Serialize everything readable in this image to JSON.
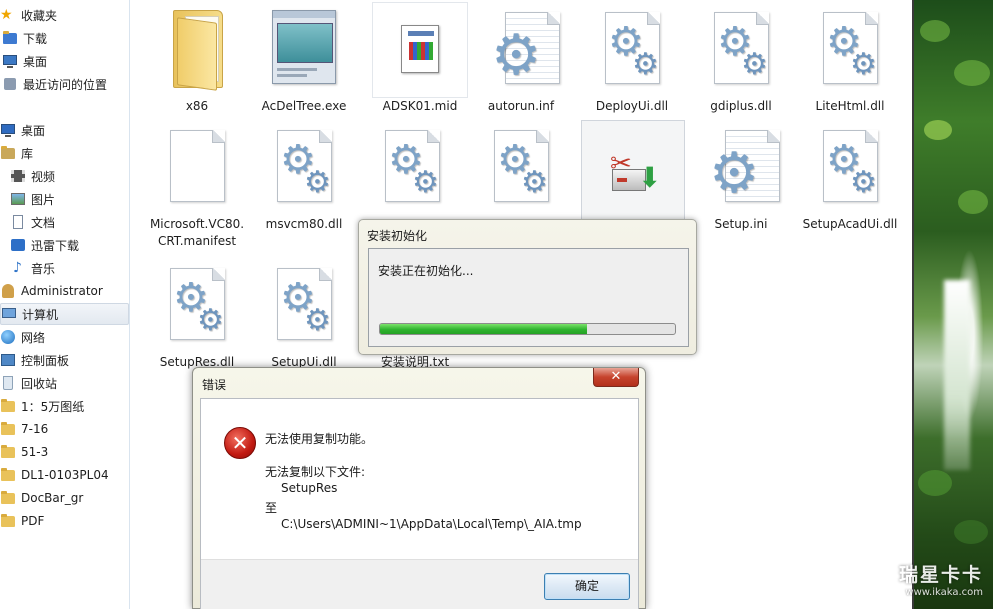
{
  "nav": {
    "items": [
      {
        "label": "收藏夹",
        "icon": "star-icon"
      },
      {
        "label": "下载",
        "icon": "download-folder-icon"
      },
      {
        "label": "桌面",
        "icon": "desktop-icon"
      },
      {
        "label": "最近访问的位置",
        "icon": "recent-places-icon"
      },
      {
        "label": "桌面",
        "icon": "desktop-icon"
      },
      {
        "label": "库",
        "icon": "library-icon"
      },
      {
        "label": "视频",
        "icon": "video-icon"
      },
      {
        "label": "图片",
        "icon": "pictures-icon"
      },
      {
        "label": "文档",
        "icon": "documents-icon"
      },
      {
        "label": "迅雷下载",
        "icon": "xunlei-download-icon"
      },
      {
        "label": "音乐",
        "icon": "music-icon"
      },
      {
        "label": "Administrator",
        "icon": "user-folder-icon"
      },
      {
        "label": "计算机",
        "icon": "computer-icon"
      },
      {
        "label": "网络",
        "icon": "network-icon"
      },
      {
        "label": "控制面板",
        "icon": "control-panel-icon"
      },
      {
        "label": "回收站",
        "icon": "recycle-bin-icon"
      },
      {
        "label": "1：5万图纸",
        "icon": "folder-icon"
      },
      {
        "label": "7-16",
        "icon": "folder-icon"
      },
      {
        "label": "51-3",
        "icon": "folder-icon"
      },
      {
        "label": "DL1-0103PL04",
        "icon": "folder-icon"
      },
      {
        "label": "DocBar_gr",
        "icon": "folder-icon"
      },
      {
        "label": "PDF",
        "icon": "folder-icon"
      }
    ],
    "selected_index": 12
  },
  "files": [
    {
      "name": "x86",
      "icon": "folder-icon"
    },
    {
      "name": "AcDelTree.exe",
      "icon": "application-icon"
    },
    {
      "name": "ADSK01.mid",
      "icon": "media-file-icon"
    },
    {
      "name": "autorun.inf",
      "icon": "config-file-icon"
    },
    {
      "name": "DeployUi.dll",
      "icon": "dll-file-icon"
    },
    {
      "name": "gdiplus.dll",
      "icon": "dll-file-icon"
    },
    {
      "name": "LiteHtml.dll",
      "icon": "dll-file-icon"
    },
    {
      "name": "Microsoft.VC80.\nCRT.manifest",
      "icon": "blank-file-icon"
    },
    {
      "name": "msvcm80.dll",
      "icon": "dll-file-icon"
    },
    {
      "name": "",
      "icon": "dll-file-icon"
    },
    {
      "name": "",
      "icon": "dll-file-icon"
    },
    {
      "name": "",
      "icon": "setup-exe-icon"
    },
    {
      "name": "Setup.ini",
      "icon": "config-file-icon"
    },
    {
      "name": "SetupAcadUi.dll",
      "icon": "dll-file-icon"
    },
    {
      "name": "SetupRes.dll",
      "icon": "dll-file-icon"
    },
    {
      "name": "SetupUi.dll",
      "icon": "dll-file-icon"
    },
    {
      "name": "安装说明.txt",
      "icon": "text-file-icon"
    }
  ],
  "install_dialog": {
    "title": "安装初始化",
    "message": "安装正在初始化...",
    "progress": 0.7
  },
  "error_dialog": {
    "title": "错误",
    "close_glyph": "✕",
    "heading": "无法使用复制功能。",
    "line1": "无法复制以下文件:",
    "file": "SetupRes",
    "to_label": "至",
    "destination": "C:\\Users\\ADMINI~1\\AppData\\Local\\Temp\\_AIA.tmp",
    "ok_label": "确定",
    "icon": "error-icon"
  },
  "watermark": {
    "main": "瑞星卡卡",
    "url": "www.ikaka.com"
  },
  "colors": {
    "progress_fill": "#2fb32f",
    "error_red": "#c21a12",
    "close_button": "#c6432d",
    "selection": "#e3e9f0"
  }
}
